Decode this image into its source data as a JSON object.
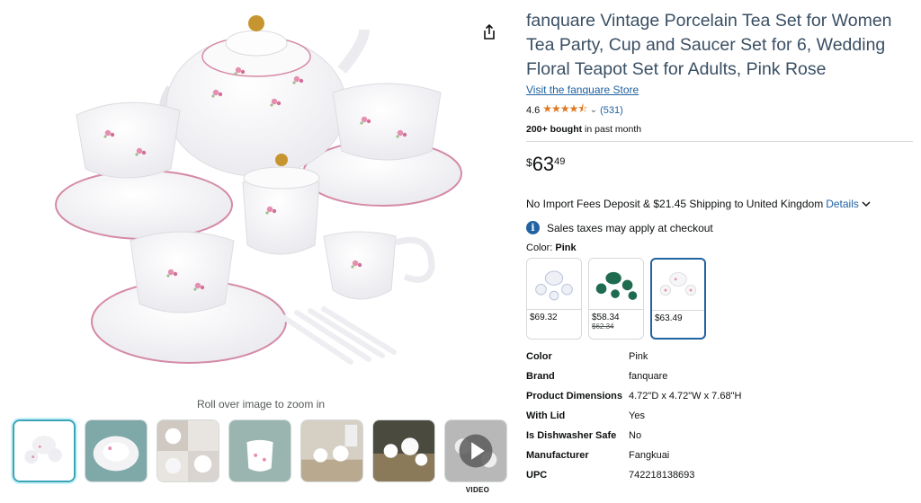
{
  "product": {
    "title": "fanquare Vintage Porcelain Tea Set for Women Tea Party, Cup and Saucer Set for 6, Wedding Floral Teapot Set for Adults, Pink Rose",
    "store_link": "Visit the fanquare Store",
    "rating": "4.6",
    "stars": "★★★★⯪",
    "review_count": "(531)",
    "bought_bold": "200+ bought",
    "bought_rest": " in past month"
  },
  "price": {
    "currency": "$",
    "whole": "63",
    "fraction": "49"
  },
  "shipping": {
    "text": "No Import Fees Deposit & $21.45 Shipping to United Kingdom",
    "details_link": "Details"
  },
  "tax_note": "Sales taxes may apply at checkout",
  "color_selector": {
    "label": "Color:",
    "selected": "Pink",
    "options": [
      {
        "price": "$69.32",
        "old_price": ""
      },
      {
        "price": "$58.34",
        "old_price": "$62.34"
      },
      {
        "price": "$63.49",
        "old_price": ""
      }
    ]
  },
  "specs": [
    {
      "key": "Color",
      "value": "Pink"
    },
    {
      "key": "Brand",
      "value": "fanquare"
    },
    {
      "key": "Product Dimensions",
      "value": "4.72\"D x 4.72\"W x 7.68\"H"
    },
    {
      "key": "With Lid",
      "value": "Yes"
    },
    {
      "key": "Is Dishwasher Safe",
      "value": "No"
    },
    {
      "key": "Manufacturer",
      "value": "Fangkuai"
    },
    {
      "key": "UPC",
      "value": "742218138693"
    }
  ],
  "gallery": {
    "zoom_hint": "Roll over image to zoom in",
    "video_label": "VIDEO"
  },
  "colors": {
    "link": "#2162a1",
    "stars": "#de7921",
    "title": "#3a4f64"
  }
}
